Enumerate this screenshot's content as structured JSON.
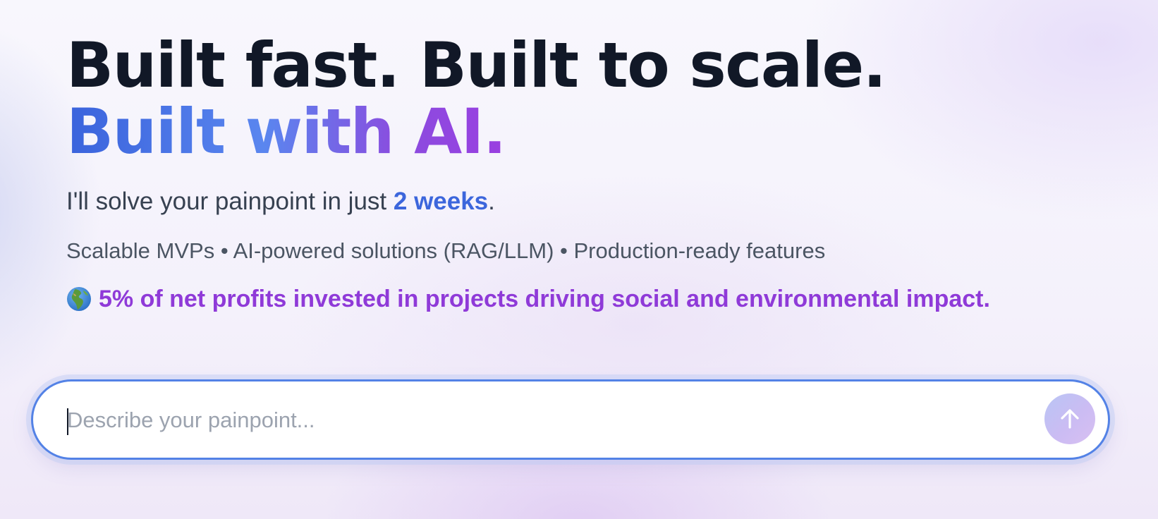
{
  "hero": {
    "title_line_1": "Built fast. Built to scale.",
    "title_line_2": "Built with AI.",
    "tagline_prefix": "I'll solve your painpoint in just ",
    "tagline_highlight": "2 weeks",
    "tagline_suffix": ".",
    "features": "Scalable MVPs • AI-powered solutions (RAG/LLM) • Production-ready features",
    "impact_icon": "globe-europe-africa-icon",
    "impact_text": "5% of net profits invested in projects driving social and environmental impact."
  },
  "chat": {
    "placeholder": "Describe your painpoint...",
    "value": "",
    "send_icon": "arrow-up-icon"
  },
  "colors": {
    "heading": "#111827",
    "gradient_start": "#3a63dc",
    "gradient_end": "#9a3fe0",
    "highlight_blue": "#3c66dc",
    "impact_purple": "#8f3ad8",
    "input_border": "#5382e6"
  }
}
